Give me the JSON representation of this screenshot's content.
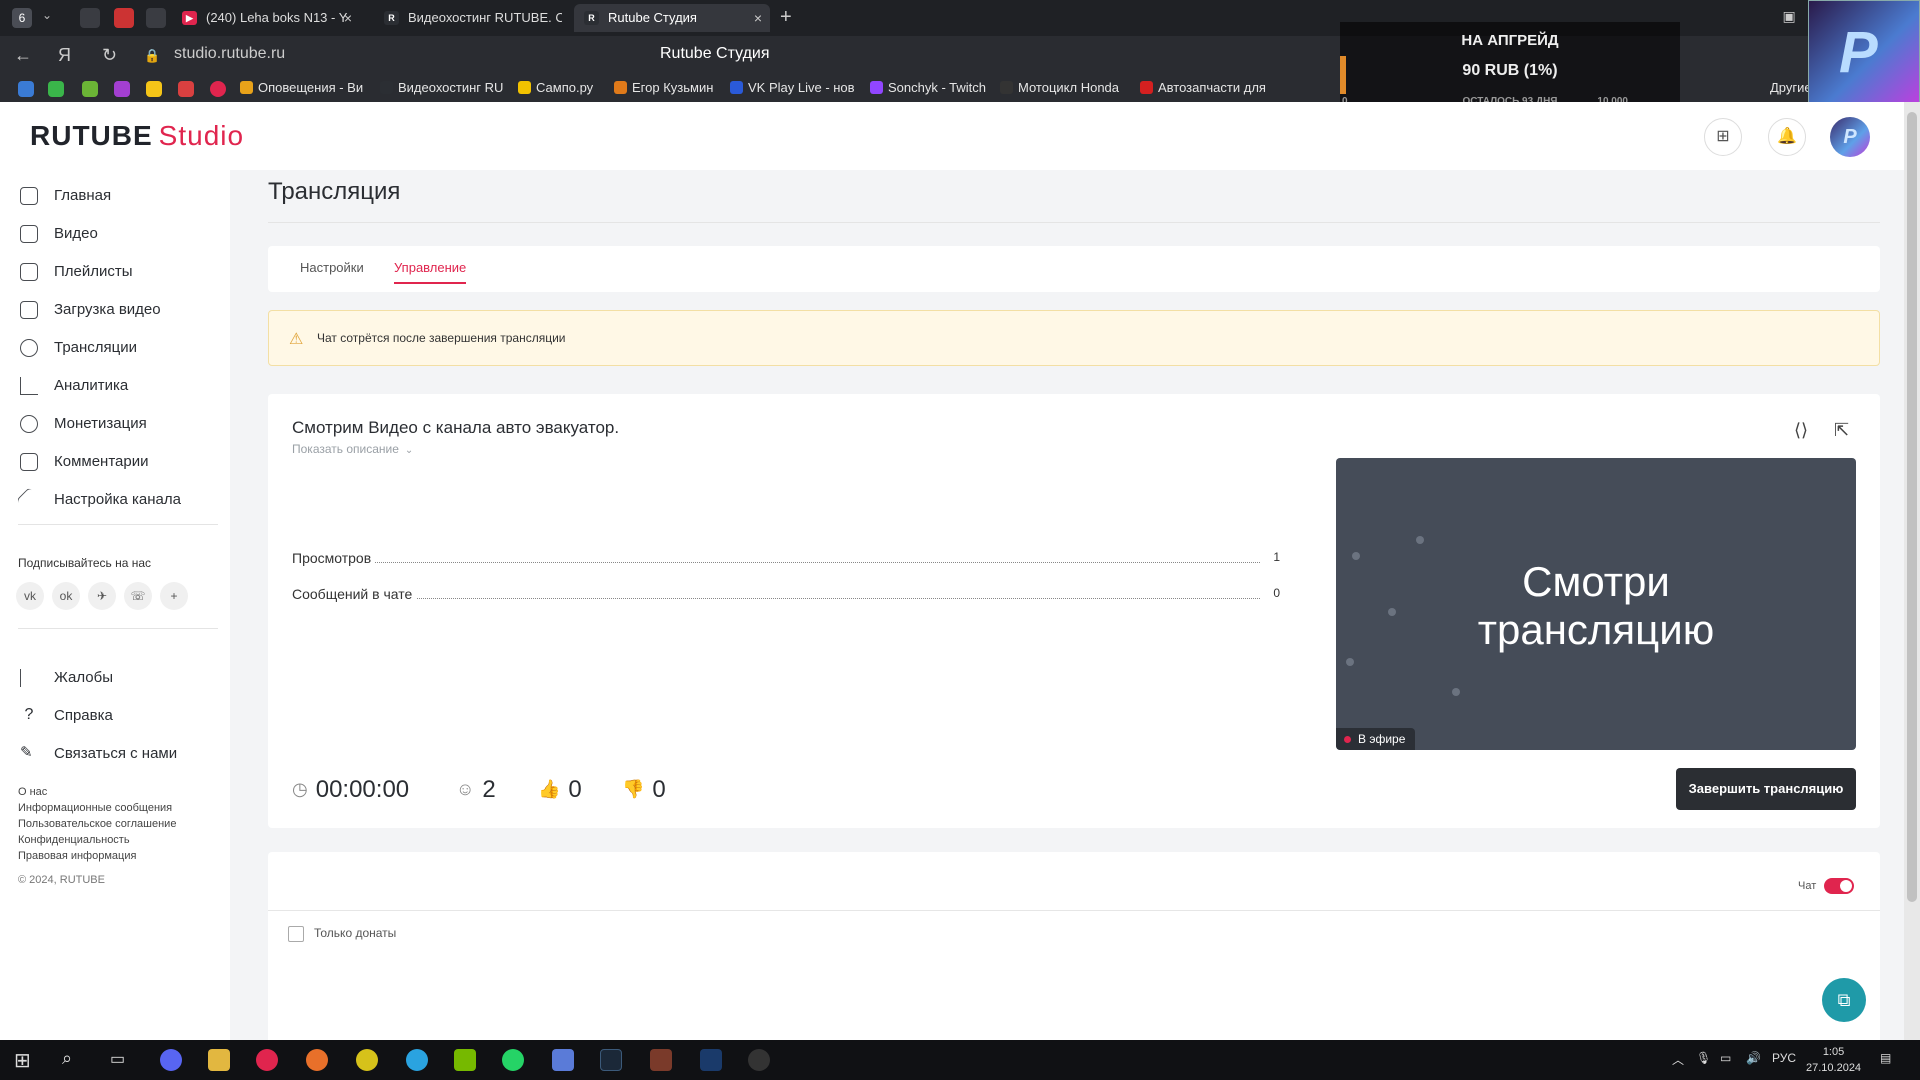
{
  "browser": {
    "tab_count": "6",
    "tabs": [
      {
        "label": "(240) Leha boks N13 - Y",
        "favicon_color": "#e0254e"
      },
      {
        "label": "Видеохостинг RUTUBE. С",
        "favicon_color": "#2b2e33"
      },
      {
        "label": "Rutube Студия",
        "favicon_color": "#2b2e33"
      }
    ],
    "url": "studio.rutube.ru",
    "page_title": "Rutube Студия",
    "bookmarks": [
      "Оповещения - Ви",
      "Видеохостинг RU",
      "Сампо.ру",
      "Егор Кузьмин",
      "VK Play Live - нов",
      "Sonchyk - Twitch",
      "Мотоцикл Honda",
      "Автозапчасти для"
    ],
    "bookmarks_other": "Другие"
  },
  "overlay": {
    "line1": "НА АПГРЕЙД",
    "line2": "90 RUB (1%)",
    "line3": "ОСТАЛОСЬ 93 ДНЯ",
    "min": "0",
    "max": "10 000",
    "progress_percent": 1
  },
  "header": {
    "logo_main": "RUTUBE",
    "logo_sub": "Studio"
  },
  "sidebar": {
    "items": [
      {
        "label": "Главная",
        "icon": "home-icon"
      },
      {
        "label": "Видео",
        "icon": "video-icon"
      },
      {
        "label": "Плейлисты",
        "icon": "playlist-icon"
      },
      {
        "label": "Загрузка видео",
        "icon": "upload-icon"
      },
      {
        "label": "Трансляции",
        "icon": "broadcast-icon"
      },
      {
        "label": "Аналитика",
        "icon": "analytics-icon"
      },
      {
        "label": "Монетизация",
        "icon": "coin-icon"
      },
      {
        "label": "Комментарии",
        "icon": "comment-icon"
      },
      {
        "label": "Настройка канала",
        "icon": "wand-icon"
      }
    ],
    "follow_label": "Подписывайтесь на нас",
    "social": [
      "vk",
      "ok",
      "tg",
      "viber",
      "+"
    ],
    "secondary": [
      {
        "label": "Жалобы",
        "icon": "flag-icon"
      },
      {
        "label": "Справка",
        "icon": "help-icon"
      },
      {
        "label": "Связаться с нами",
        "icon": "edit-icon"
      }
    ],
    "footer_links": [
      "О нас",
      "Информационные сообщения",
      "Пользовательское соглашение",
      "Конфиденциальность",
      "Правовая информация"
    ],
    "copyright": "© 2024, RUTUBE"
  },
  "main": {
    "title": "Трансляция",
    "tabs": [
      {
        "label": "Настройки",
        "active": false
      },
      {
        "label": "Управление",
        "active": true
      }
    ],
    "warning": "Чат сотрётся после завершения трансляции",
    "stream": {
      "title": "Смотрим Видео с канала авто эвакуатор.",
      "show_description": "Показать описание",
      "stats": [
        {
          "label": "Просмотров",
          "value": "1"
        },
        {
          "label": "Сообщений в чате",
          "value": "0"
        }
      ],
      "duration": "00:00:00",
      "viewers": "2",
      "likes": "0",
      "dislikes": "0",
      "preview_text_1": "Смотри",
      "preview_text_2": "трансляцию",
      "live_label": "В эфире",
      "end_button": "Завершить трансляцию"
    },
    "chat": {
      "label": "Чат",
      "enabled": true,
      "only_donations_label": "Только донаты",
      "only_donations_checked": false
    }
  },
  "taskbar": {
    "lang": "РУС",
    "time": "1:05",
    "date": "27.10.2024"
  }
}
